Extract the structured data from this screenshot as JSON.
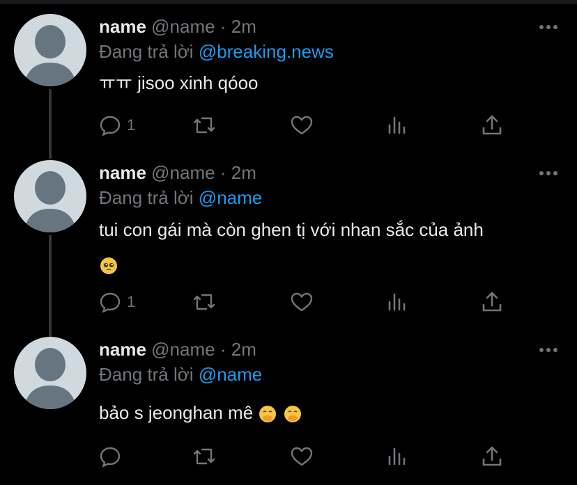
{
  "theme": {
    "background": "#000000",
    "text": "#e7e9ea",
    "muted": "#71767b",
    "accent": "#1d9bf0",
    "avatar": "#cfd9de"
  },
  "tweets": [
    {
      "name": "name",
      "handle": "@name",
      "dot": "·",
      "time": "2m",
      "reply_prefix": "Đang trả lời",
      "reply_to": "@breaking.news",
      "text": "ㅠㅠ jisoo xinh qóoo",
      "emojis": [],
      "reply_count": "1",
      "icons": [
        "reply-icon",
        "retweet-icon",
        "like-icon",
        "analytics-icon",
        "share-icon"
      ]
    },
    {
      "name": "name",
      "handle": "@name",
      "dot": "·",
      "time": "2m",
      "reply_prefix": "Đang trả lời",
      "reply_to": "@name",
      "text": "tui con gái mà còn ghen tị với nhan sắc của ảnh",
      "emojis": [
        "pleading-face-emoji"
      ],
      "reply_count": "1",
      "icons": [
        "reply-icon",
        "retweet-icon",
        "like-icon",
        "analytics-icon",
        "share-icon"
      ]
    },
    {
      "name": "name",
      "handle": "@name",
      "dot": "·",
      "time": "2m",
      "reply_prefix": "Đang trả lời",
      "reply_to": "@name",
      "text": "bảo s jeonghan mê",
      "emojis": [
        "hand-over-mouth-emoji",
        "hand-over-mouth-emoji"
      ],
      "reply_count": "",
      "icons": [
        "reply-icon",
        "retweet-icon",
        "like-icon",
        "analytics-icon",
        "share-icon"
      ]
    }
  ]
}
